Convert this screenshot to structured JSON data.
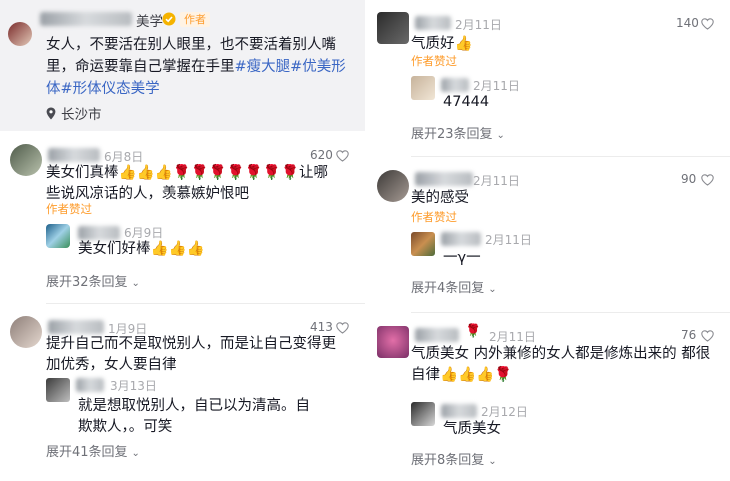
{
  "post": {
    "author_suffix": "美学",
    "author_badge": "作者",
    "text": "女人，不要活在别人眼里，也不要活着别人嘴里，命运要靠自己掌握在手里",
    "tags": "#瘦大腿#优美形体#形体仪态美学",
    "location": "长沙市"
  },
  "comments_left": [
    {
      "date": "6月8日",
      "likes": "620",
      "text": "美女们真棒👍👍👍🌹🌹🌹🌹🌹🌹🌹让哪些说风凉话的人，羡慕嫉妒恨吧",
      "liked_by_author": "作者赞过",
      "reply": {
        "date": "6月9日",
        "text": "美女们好棒👍👍👍"
      },
      "expand": "展开32条回复"
    },
    {
      "date": "1月9日",
      "likes": "413",
      "text": "提升自己而不是取悦别人，而是让自己变得更加优秀，女人要自律",
      "reply": {
        "date": "3月13日",
        "text": "就是想取悦别人，自已以为清高。自欺欺人，。可笑"
      },
      "expand": "展开41条回复"
    }
  ],
  "comments_right": [
    {
      "date": "2月11日",
      "likes": "140",
      "text": "气质好👍",
      "liked_by_author": "作者赞过",
      "reply": {
        "date": "2月11日",
        "text": "47444"
      },
      "expand": "展开23条回复"
    },
    {
      "date": "2月11日",
      "likes": "90",
      "text": "美的感受",
      "liked_by_author": "作者赞过",
      "reply": {
        "date": "2月11日",
        "text": "一γ一"
      },
      "expand": "展开4条回复"
    },
    {
      "date": "2月11日",
      "likes": "76",
      "text": "气质美女  内外兼修的女人都是修炼出来的  都很自律👍👍👍🌹",
      "reply": {
        "date": "2月12日",
        "text": "气质美女"
      },
      "expand": "展开8条回复"
    }
  ],
  "colors": {
    "badge": "#fe9d2e",
    "link": "#3a66c4",
    "secondary": "#a8a9ad"
  },
  "icons": {
    "like": "heart-outline-icon",
    "location": "location-pin-icon",
    "expand": "chevron-down-icon",
    "verified": "verified-badge-icon"
  }
}
